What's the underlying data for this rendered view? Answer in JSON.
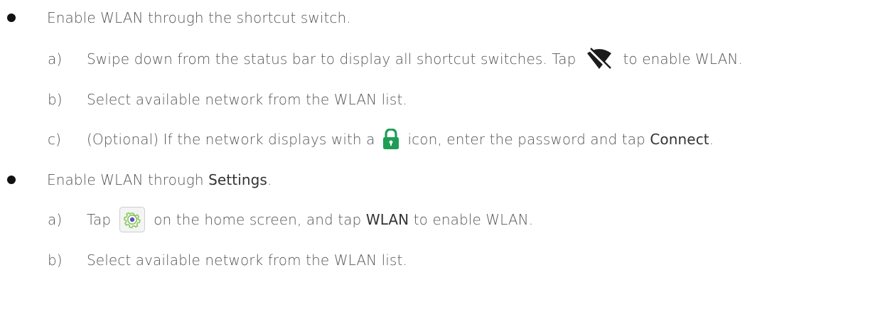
{
  "bullets": [
    {
      "text": "Enable WLAN through the shortcut switch.",
      "steps": [
        {
          "marker": "a)",
          "before": "Swipe down from the status bar to display all shortcut switches. Tap",
          "icon": "wifi-off-icon",
          "after": "to enable WLAN."
        },
        {
          "marker": "b)",
          "text": "Select available network from the WLAN list."
        },
        {
          "marker": "c)",
          "before": "(Optional) If the network displays with a",
          "icon": "lock-icon",
          "middle": "icon, enter the password and tap",
          "bold": "Connect",
          "after": "."
        }
      ]
    },
    {
      "before": "Enable WLAN through",
      "bold": "Settings",
      "after": ".",
      "steps": [
        {
          "marker": "a)",
          "before": "Tap",
          "icon": "settings-icon",
          "middle": "on the home screen, and tap",
          "bold": "WLAN",
          "after": "to enable WLAN."
        },
        {
          "marker": "b)",
          "text": "Select available network from the WLAN list."
        }
      ]
    }
  ],
  "colors": {
    "text": "#555555",
    "bullet": "#111111",
    "lock_icon": "#1f9d55",
    "settings_icon_ring": "#7cc242",
    "settings_icon_center": "#5a4fcf",
    "wifi_icon": "#1c1c1c"
  }
}
